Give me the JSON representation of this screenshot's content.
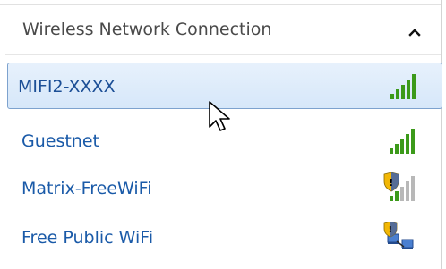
{
  "section": {
    "title": "Wireless Network Connection",
    "collapse_icon": "chevron-up-icon"
  },
  "networks": [
    {
      "name": "MIFI2-XXXX",
      "selected": true,
      "signal": 5,
      "secured": false,
      "icon": "signal-bars-icon"
    },
    {
      "name": "Guestnet",
      "selected": false,
      "signal": 5,
      "secured": false,
      "icon": "signal-bars-icon"
    },
    {
      "name": "Matrix-FreeWiFi",
      "selected": false,
      "signal": 2,
      "secured": false,
      "icon": "signal-bars-shield-icon"
    },
    {
      "name": "Free Public WiFi",
      "selected": false,
      "signal": 0,
      "secured": false,
      "icon": "adhoc-network-shield-icon"
    }
  ],
  "colors": {
    "link": "#1a5aa8",
    "selected_border": "#7da2ce",
    "signal_green": "#3c9a1a",
    "signal_grey": "#b8b8b8",
    "shield_yellow": "#f2b705"
  }
}
